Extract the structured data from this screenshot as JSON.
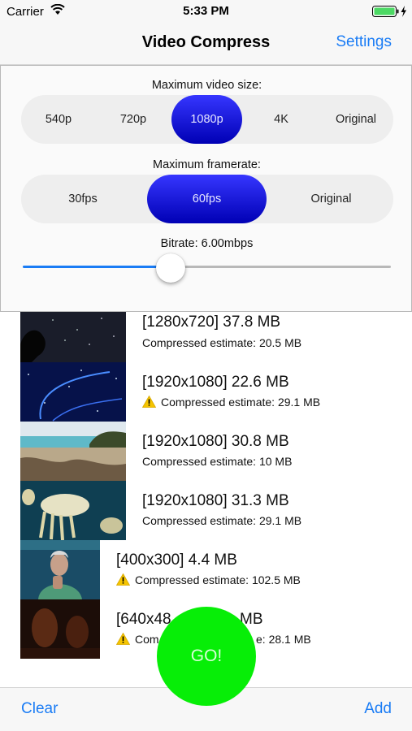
{
  "status_bar": {
    "carrier": "Carrier",
    "time": "5:33 PM"
  },
  "nav": {
    "title": "Video Compress",
    "settings_label": "Settings"
  },
  "settings": {
    "video_size_label": "Maximum video size:",
    "video_size_options": [
      "540p",
      "720p",
      "1080p",
      "4K",
      "Original"
    ],
    "video_size_selected": "1080p",
    "framerate_label": "Maximum framerate:",
    "framerate_options": [
      "30fps",
      "60fps",
      "Original"
    ],
    "framerate_selected": "60fps",
    "bitrate_label": "Bitrate: 6.00mbps",
    "bitrate_slider_fraction": 0.4
  },
  "videos": [
    {
      "title": "[1280x720] 37.8 MB",
      "estimate": "Compressed estimate: 20.5 MB",
      "warning": false
    },
    {
      "title": "[1920x1080] 22.6 MB",
      "estimate": "Compressed estimate: 29.1 MB",
      "warning": true
    },
    {
      "title": "[1920x1080] 30.8 MB",
      "estimate": "Compressed estimate: 10 MB",
      "warning": false
    },
    {
      "title": "[1920x1080] 31.3 MB",
      "estimate": "Compressed estimate: 29.1 MB",
      "warning": false
    },
    {
      "title": "[400x300] 4.4 MB",
      "estimate": "Compressed estimate: 102.5 MB",
      "warning": true
    },
    {
      "title": "[640x48",
      "title_tail": "MB",
      "estimate": "Com",
      "estimate_tail": "e: 28.1 MB",
      "warning": true
    }
  ],
  "go_button": {
    "label": "GO!",
    "color": "#07ee07"
  },
  "toolbar": {
    "clear_label": "Clear",
    "add_label": "Add"
  },
  "colors": {
    "accent": "#1a7cf5",
    "segment_selected": "#1a1ae0",
    "warning": "#f5c400"
  }
}
